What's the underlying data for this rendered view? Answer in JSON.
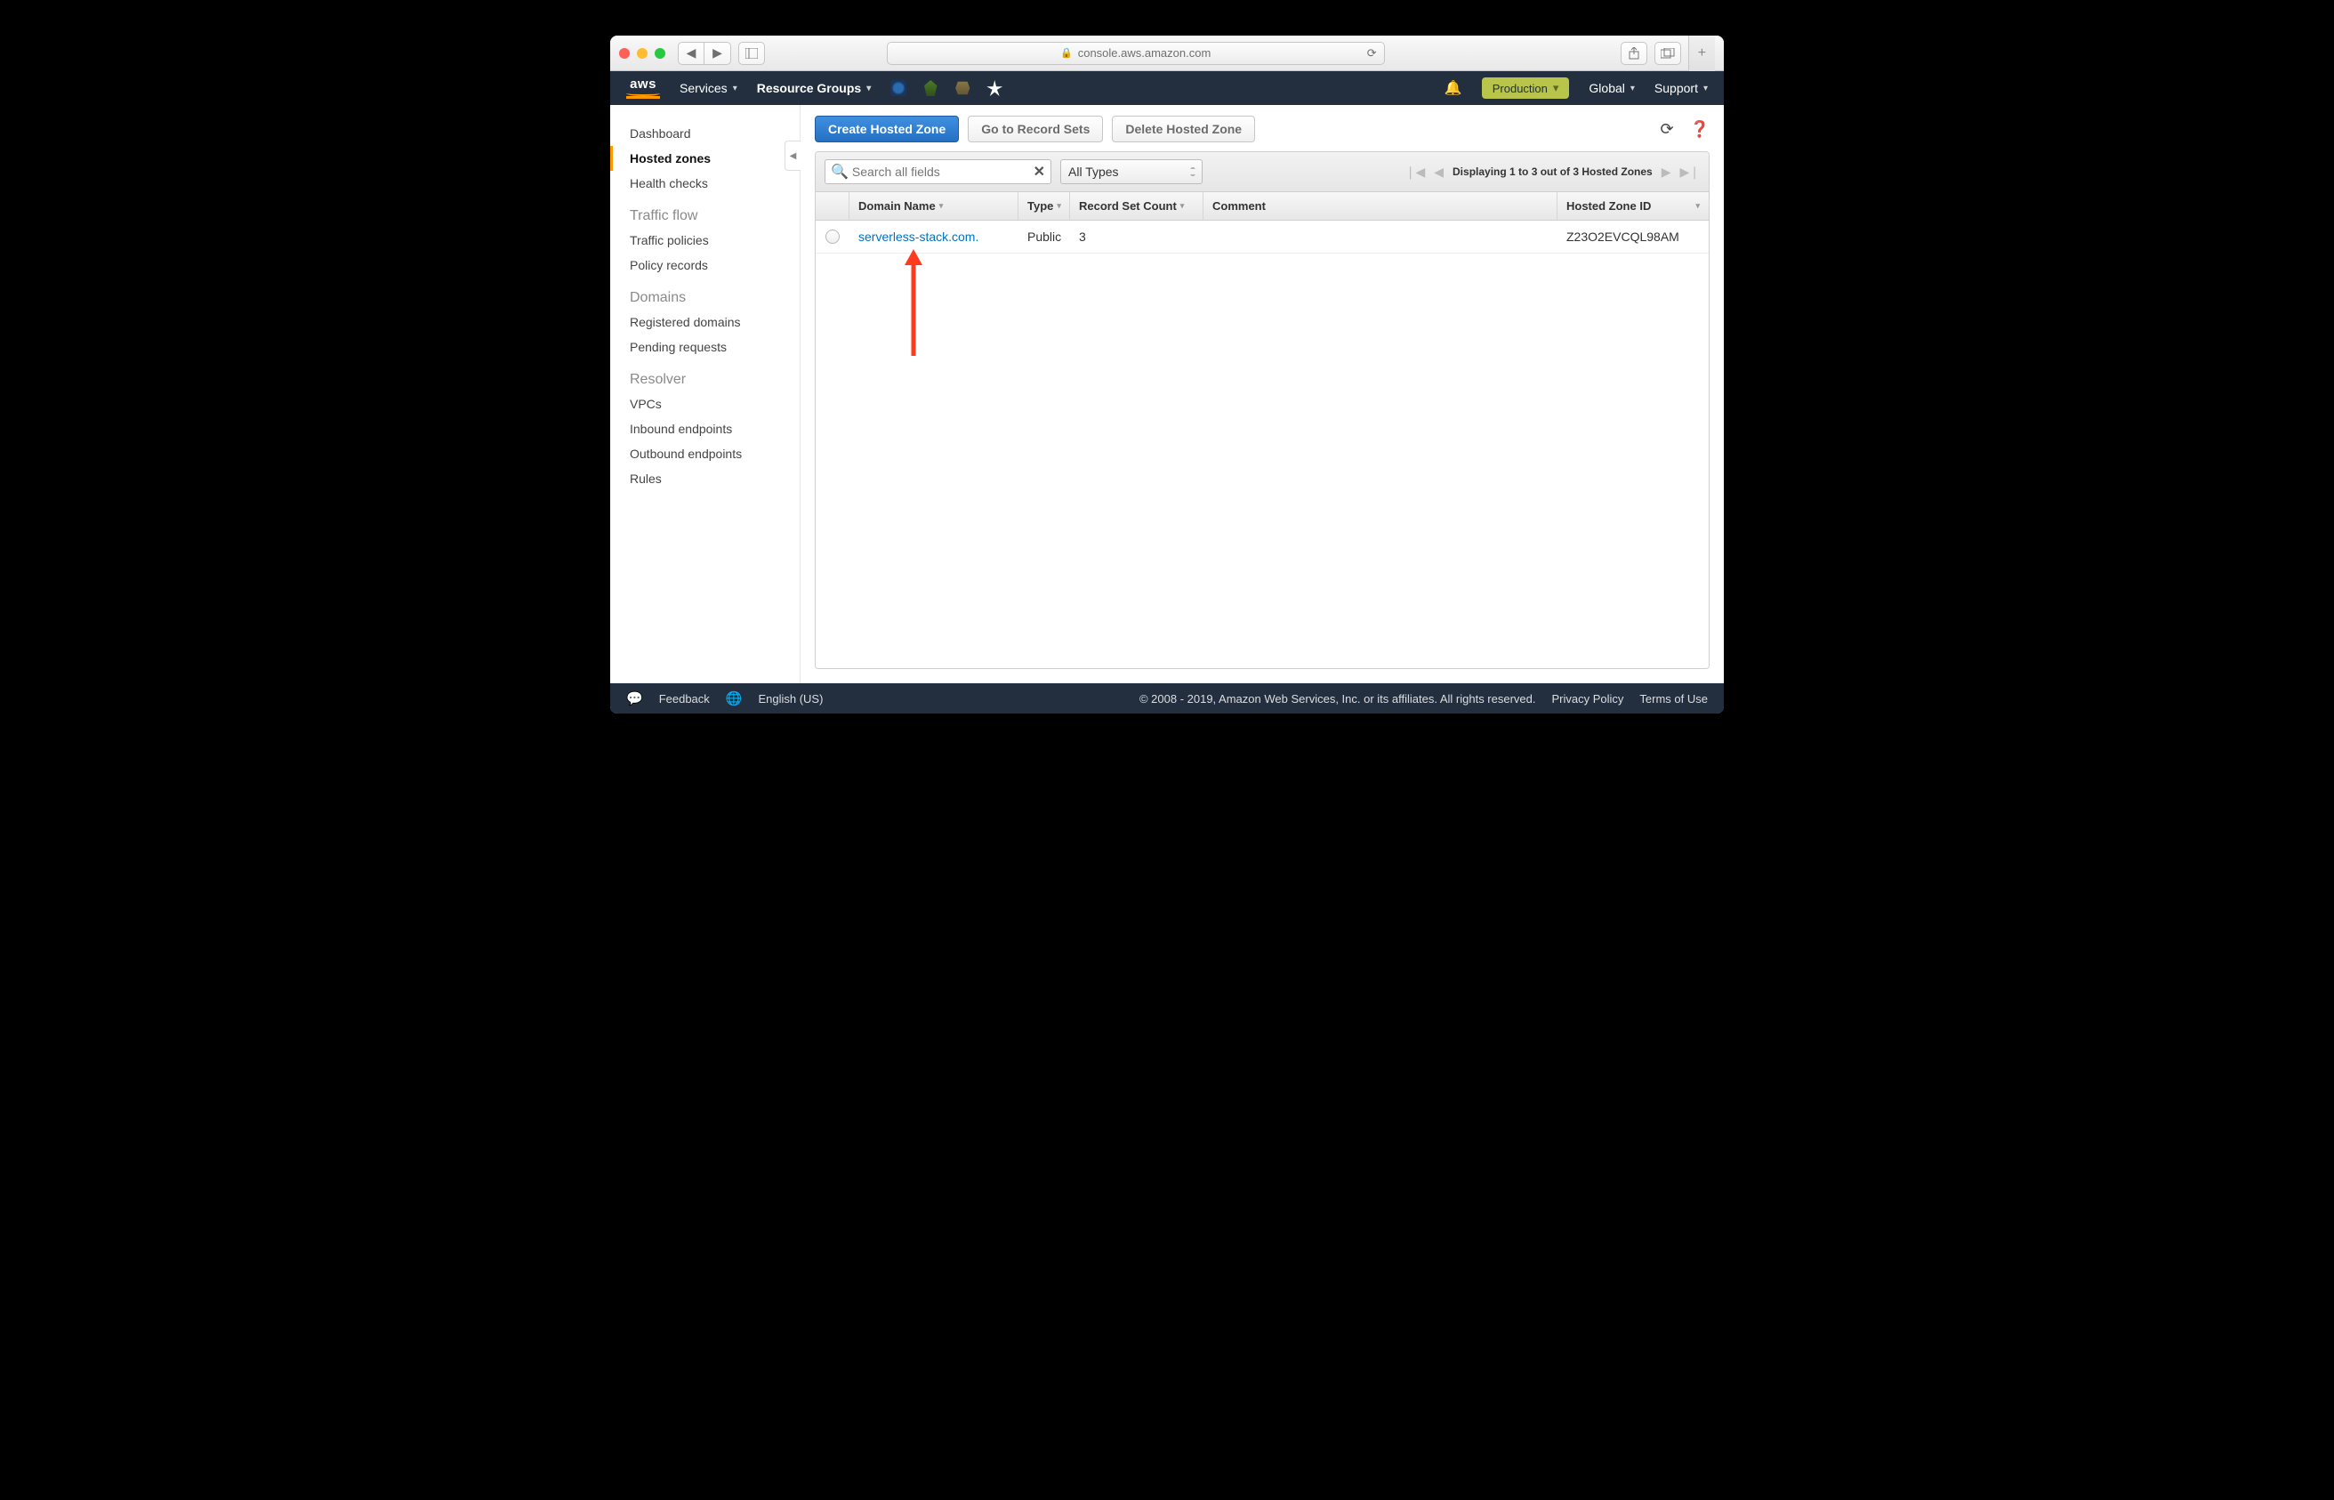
{
  "browser": {
    "url_host": "console.aws.amazon.com"
  },
  "topnav": {
    "services": "Services",
    "resource_groups": "Resource Groups",
    "environment": "Production",
    "region": "Global",
    "support": "Support"
  },
  "sidebar": {
    "items": [
      "Dashboard",
      "Hosted zones",
      "Health checks"
    ],
    "traffic_heading": "Traffic flow",
    "traffic_items": [
      "Traffic policies",
      "Policy records"
    ],
    "domains_heading": "Domains",
    "domains_items": [
      "Registered domains",
      "Pending requests"
    ],
    "resolver_heading": "Resolver",
    "resolver_items": [
      "VPCs",
      "Inbound endpoints",
      "Outbound endpoints",
      "Rules"
    ]
  },
  "toolbar": {
    "create": "Create Hosted Zone",
    "goto": "Go to Record Sets",
    "delete": "Delete Hosted Zone"
  },
  "filter": {
    "search_placeholder": "Search all fields",
    "type_filter": "All Types",
    "pager_status": "Displaying 1 to 3 out of 3 Hosted Zones"
  },
  "table": {
    "headers": {
      "domain": "Domain Name",
      "type": "Type",
      "rsc": "Record Set Count",
      "comment": "Comment",
      "hzid": "Hosted Zone ID"
    },
    "rows": [
      {
        "domain": "serverless-stack.com.",
        "type": "Public",
        "rsc": "3",
        "comment": "",
        "hzid": "Z23O2EVCQL98AM"
      }
    ]
  },
  "footer": {
    "feedback": "Feedback",
    "language": "English (US)",
    "copyright": "© 2008 - 2019, Amazon Web Services, Inc. or its affiliates. All rights reserved.",
    "privacy": "Privacy Policy",
    "terms": "Terms of Use"
  }
}
